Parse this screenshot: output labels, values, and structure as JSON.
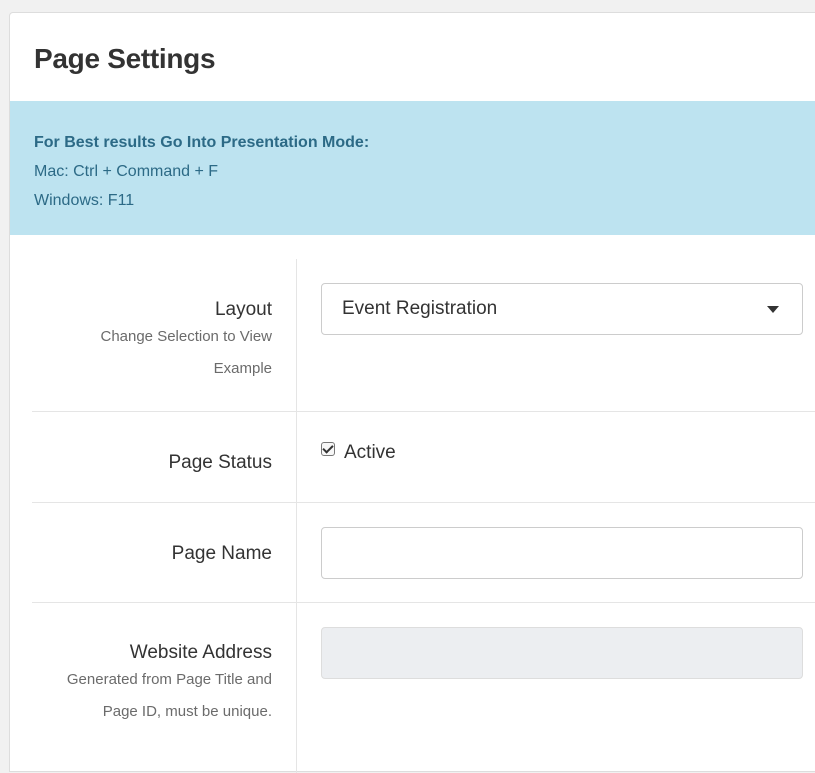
{
  "panel": {
    "title": "Page Settings"
  },
  "alert": {
    "heading": "For Best results Go Into Presentation Mode:",
    "line1": "Mac: Ctrl + Command + F",
    "line2": "Windows: F11"
  },
  "form": {
    "layout": {
      "label": "Layout",
      "help_line1": "Change Selection to View",
      "help_line2": "Example",
      "selected": "Event Registration"
    },
    "status": {
      "label": "Page Status",
      "checkbox_label": "Active",
      "checked": true
    },
    "page_name": {
      "label": "Page Name",
      "value": ""
    },
    "website_address": {
      "label": "Website Address",
      "help_line1": "Generated from Page Title and",
      "help_line2": "Page ID, must be unique.",
      "value": ""
    }
  },
  "colors": {
    "alert_bg": "#bde3f0",
    "alert_text": "#2c6a86",
    "readonly_bg": "#eceef1"
  }
}
